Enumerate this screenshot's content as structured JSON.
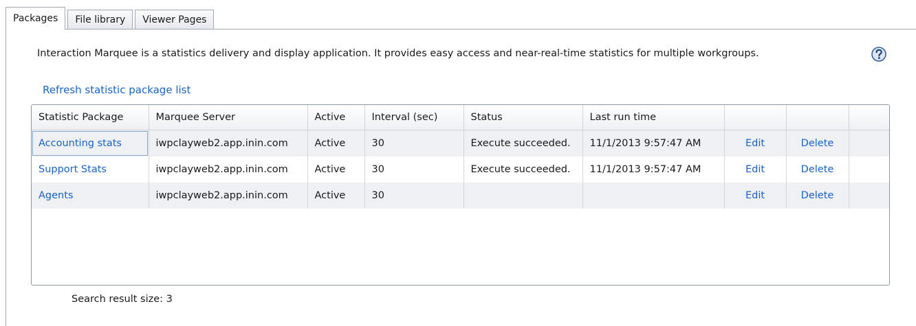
{
  "tabs": [
    "Packages",
    "File library",
    "Viewer Pages"
  ],
  "description": "Interaction Marquee is a statistics delivery and display application.  It provides easy access and near-real-time statistics for multiple workgroups.",
  "help_icon": "question-mark-circle-icon",
  "refresh_link": "Refresh statistic package list",
  "table": {
    "columns": [
      "Statistic Package",
      "Marquee Server",
      "Active",
      "Interval (sec)",
      "Status",
      "Last run time",
      "",
      "",
      ""
    ],
    "rows": [
      {
        "package": "Accounting stats",
        "server": "iwpclayweb2.app.inin.com",
        "active": "Active",
        "interval": "30",
        "status": "Execute succeeded.",
        "last_run": "11/1/2013 9:57:47 AM",
        "edit": "Edit",
        "delete": "Delete"
      },
      {
        "package": "Support Stats",
        "server": "iwpclayweb2.app.inin.com",
        "active": "Active",
        "interval": "30",
        "status": "Execute succeeded.",
        "last_run": "11/1/2013 9:57:47 AM",
        "edit": "Edit",
        "delete": "Delete"
      },
      {
        "package": "Agents",
        "server": "iwpclayweb2.app.inin.com",
        "active": "Active",
        "interval": "30",
        "status": "",
        "last_run": "",
        "edit": "Edit",
        "delete": "Delete"
      }
    ]
  },
  "search_result": "Search result size: 3",
  "colors": {
    "link": "#1b62c9",
    "border": "#9ea7b3",
    "alt_row": "#eef0f4"
  }
}
